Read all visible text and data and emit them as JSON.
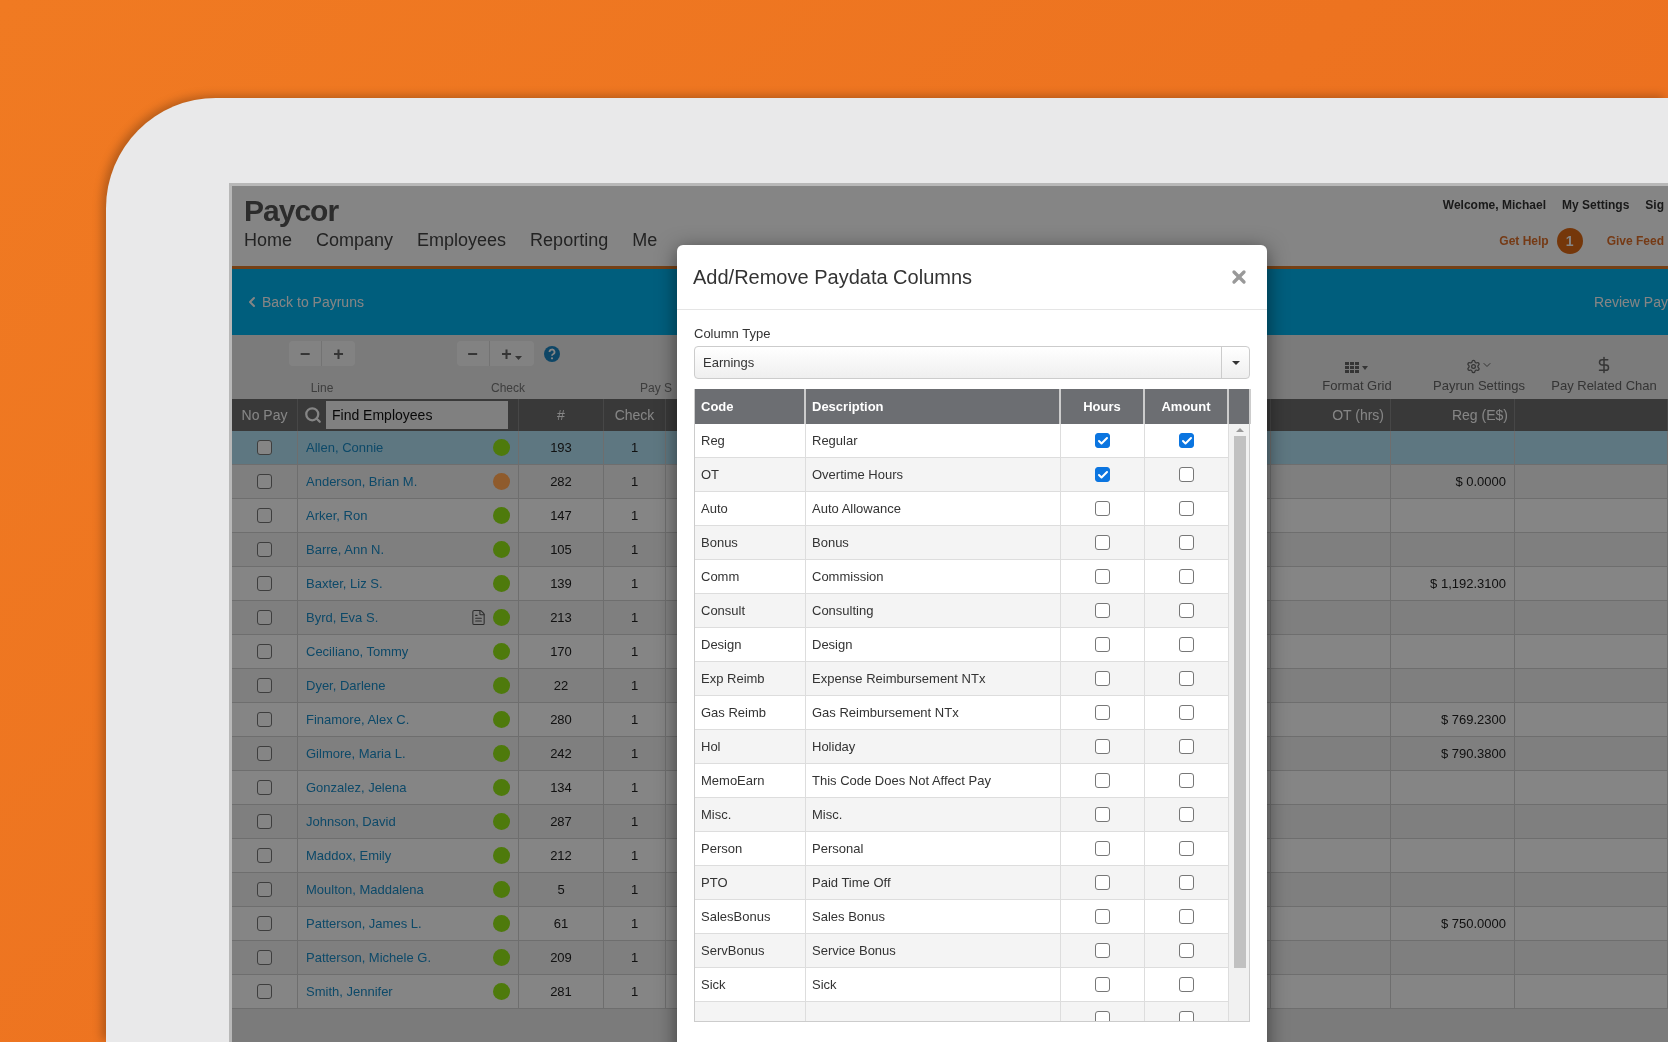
{
  "header": {
    "logo": "Paycor",
    "nav": [
      {
        "label": "Home"
      },
      {
        "label": "Company"
      },
      {
        "label": "Employees"
      },
      {
        "label": "Reporting"
      },
      {
        "label": "Me"
      }
    ],
    "user_links": [
      "Welcome, Michael",
      "My Settings",
      "Sig"
    ],
    "help": {
      "label": "Get Help",
      "badge": "1"
    },
    "feedback": "Give Feed"
  },
  "action_bar": {
    "back": "Back to Payruns",
    "review": "Review Pay"
  },
  "toolbar": {
    "line": {
      "minus": "−",
      "plus": "+",
      "label": "Line"
    },
    "check": {
      "minus": "−",
      "plus": "+",
      "label": "Check"
    },
    "pay_label": "Pay S",
    "tools": [
      {
        "label": "Format Grid"
      },
      {
        "label": "Payrun Settings"
      },
      {
        "label": "Pay Related Chan"
      }
    ]
  },
  "grid": {
    "columns": {
      "no_pay": "No Pay",
      "search_placeholder": "Find Employees",
      "number": "#",
      "check": "Check",
      "ot": "OT (hrs)",
      "reg": "Reg (E$)"
    },
    "rows": [
      {
        "name": "Allen, Connie",
        "color": "#4e7a0c",
        "note": false,
        "number": "193",
        "check": "1",
        "reg": "",
        "checked": false,
        "selected": true
      },
      {
        "name": "Anderson, Brian M.",
        "color": "#8f5b2c",
        "note": false,
        "number": "282",
        "check": "1",
        "reg": "$ 0.0000",
        "checked": false,
        "selected": false
      },
      {
        "name": "Arker, Ron",
        "color": "#4e7a0c",
        "note": false,
        "number": "147",
        "check": "1",
        "reg": "",
        "checked": false,
        "selected": false
      },
      {
        "name": "Barre, Ann N.",
        "color": "#4e7a0c",
        "note": false,
        "number": "105",
        "check": "1",
        "reg": "",
        "checked": false,
        "selected": false
      },
      {
        "name": "Baxter, Liz S.",
        "color": "#4e7a0c",
        "note": false,
        "number": "139",
        "check": "1",
        "reg": "$ 1,192.3100",
        "checked": false,
        "selected": false
      },
      {
        "name": "Byrd, Eva S.",
        "color": "#4e7a0c",
        "note": true,
        "number": "213",
        "check": "1",
        "reg": "",
        "checked": false,
        "selected": false
      },
      {
        "name": "Ceciliano, Tommy",
        "color": "#4e7a0c",
        "note": false,
        "number": "170",
        "check": "1",
        "reg": "",
        "checked": false,
        "selected": false
      },
      {
        "name": "Dyer, Darlene",
        "color": "#4e7a0c",
        "note": false,
        "number": "22",
        "check": "1",
        "reg": "",
        "checked": false,
        "selected": false
      },
      {
        "name": "Finamore, Alex C.",
        "color": "#4e7a0c",
        "note": false,
        "number": "280",
        "check": "1",
        "reg": "$ 769.2300",
        "checked": false,
        "selected": false
      },
      {
        "name": "Gilmore, Maria L.",
        "color": "#4e7a0c",
        "note": false,
        "number": "242",
        "check": "1",
        "reg": "$ 790.3800",
        "checked": false,
        "selected": false
      },
      {
        "name": "Gonzalez, Jelena",
        "color": "#4e7a0c",
        "note": false,
        "number": "134",
        "check": "1",
        "reg": "",
        "checked": false,
        "selected": false
      },
      {
        "name": "Johnson, David",
        "color": "#4e7a0c",
        "note": false,
        "number": "287",
        "check": "1",
        "reg": "",
        "checked": false,
        "selected": false
      },
      {
        "name": "Maddox, Emily",
        "color": "#4e7a0c",
        "note": false,
        "number": "212",
        "check": "1",
        "reg": "",
        "checked": false,
        "selected": false
      },
      {
        "name": "Moulton, Maddalena",
        "color": "#4e7a0c",
        "note": false,
        "number": "5",
        "check": "1",
        "reg": "",
        "checked": false,
        "selected": false
      },
      {
        "name": "Patterson, James L.",
        "color": "#4e7a0c",
        "note": false,
        "number": "61",
        "check": "1",
        "reg": "$ 750.0000",
        "checked": false,
        "selected": false
      },
      {
        "name": "Patterson, Michele G.",
        "color": "#4e7a0c",
        "note": false,
        "number": "209",
        "check": "1",
        "reg": "",
        "checked": false,
        "selected": false
      },
      {
        "name": "Smith, Jennifer",
        "color": "#4e7a0c",
        "note": false,
        "number": "281",
        "check": "1",
        "reg": "",
        "checked": false,
        "selected": false
      }
    ]
  },
  "modal": {
    "title": "Add/Remove Paydata Columns",
    "column_type_label": "Column Type",
    "column_type_value": "Earnings",
    "columns": [
      "Code",
      "Description",
      "Hours",
      "Amount"
    ],
    "rows": [
      {
        "code": "Reg",
        "description": "Regular",
        "hours": true,
        "amount": true
      },
      {
        "code": "OT",
        "description": "Overtime Hours",
        "hours": true,
        "amount": false
      },
      {
        "code": "Auto",
        "description": "Auto Allowance",
        "hours": false,
        "amount": false
      },
      {
        "code": "Bonus",
        "description": "Bonus",
        "hours": false,
        "amount": false
      },
      {
        "code": "Comm",
        "description": "Commission",
        "hours": false,
        "amount": false
      },
      {
        "code": "Consult",
        "description": "Consulting",
        "hours": false,
        "amount": false
      },
      {
        "code": "Design",
        "description": "Design",
        "hours": false,
        "amount": false
      },
      {
        "code": "Exp Reimb",
        "description": "Expense Reimbursement NTx",
        "hours": false,
        "amount": false
      },
      {
        "code": "Gas Reimb",
        "description": "Gas Reimbursement NTx",
        "hours": false,
        "amount": false
      },
      {
        "code": "Hol",
        "description": "Holiday",
        "hours": false,
        "amount": false
      },
      {
        "code": "MemoEarn",
        "description": "This Code Does Not Affect Pay",
        "hours": false,
        "amount": false
      },
      {
        "code": "Misc.",
        "description": "Misc.",
        "hours": false,
        "amount": false
      },
      {
        "code": "Person",
        "description": "Personal",
        "hours": false,
        "amount": false
      },
      {
        "code": "PTO",
        "description": "Paid Time Off",
        "hours": false,
        "amount": false
      },
      {
        "code": "SalesBonus",
        "description": "Sales Bonus",
        "hours": false,
        "amount": false
      },
      {
        "code": "ServBonus",
        "description": "Service Bonus",
        "hours": false,
        "amount": false
      },
      {
        "code": "Sick",
        "description": "Sick",
        "hours": false,
        "amount": false
      },
      {
        "hours": false,
        "amount": false
      }
    ]
  }
}
